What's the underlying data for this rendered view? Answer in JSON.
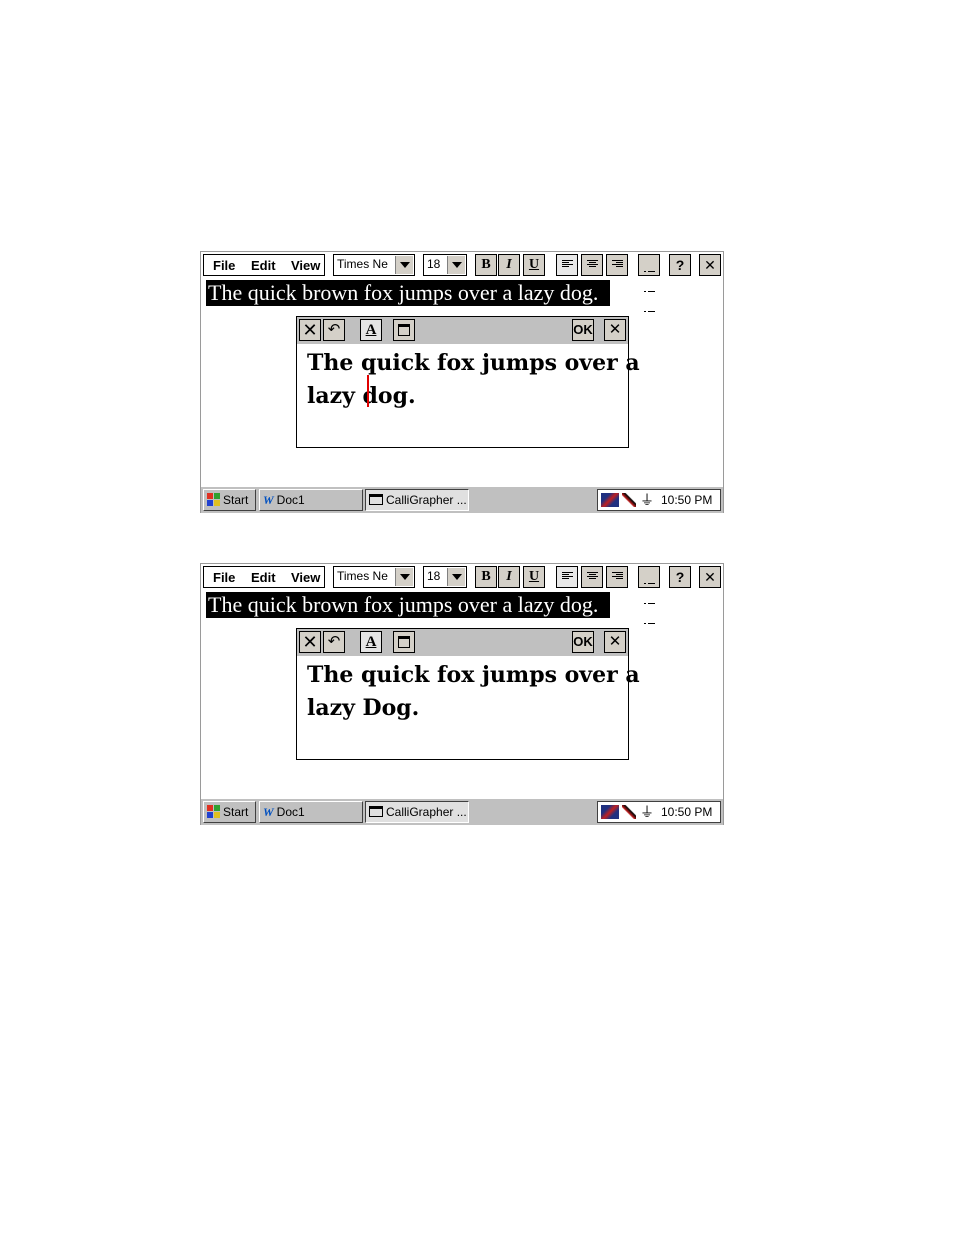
{
  "screens": [
    {
      "menu": {
        "file": "File",
        "edit": "Edit",
        "view": "View"
      },
      "font_name": "Times Ne",
      "font_size": "18",
      "buttons": {
        "bold": "B",
        "italic": "I",
        "underline": "U",
        "help": "?",
        "close": "✕"
      },
      "document_selected_text": "The quick brown fox jumps over a lazy dog.",
      "calligrapher": {
        "text_line1": "The quick fox jumps over a",
        "text_line2": "lazy dog.",
        "ok_label": "OK",
        "close_label": "✕"
      },
      "taskbar": {
        "start": "Start",
        "doc": "Doc1",
        "app": "CalliGrapher ...",
        "clock": "10:50 PM"
      }
    },
    {
      "menu": {
        "file": "File",
        "edit": "Edit",
        "view": "View"
      },
      "font_name": "Times Ne",
      "font_size": "18",
      "buttons": {
        "bold": "B",
        "italic": "I",
        "underline": "U",
        "help": "?",
        "close": "✕"
      },
      "document_selected_text": "The quick brown fox jumps over a lazy dog.",
      "calligrapher": {
        "text_line1": "The quick fox jumps over a",
        "text_line2": "lazy Dog.",
        "ok_label": "OK",
        "close_label": "✕"
      },
      "taskbar": {
        "start": "Start",
        "doc": "Doc1",
        "app": "CalliGrapher ...",
        "clock": "10:50 PM"
      }
    }
  ],
  "colors": {
    "ink_caret": "#e00000",
    "selection": "#000000",
    "chrome": "#c0c0c0"
  },
  "icons": [
    "windows-logo-icon",
    "word-icon",
    "window-icon",
    "tray-tools-icon",
    "power-plug-icon",
    "cancel-x-icon",
    "undo-icon",
    "text-mode-icon",
    "window-mode-icon",
    "bullets-icon"
  ]
}
